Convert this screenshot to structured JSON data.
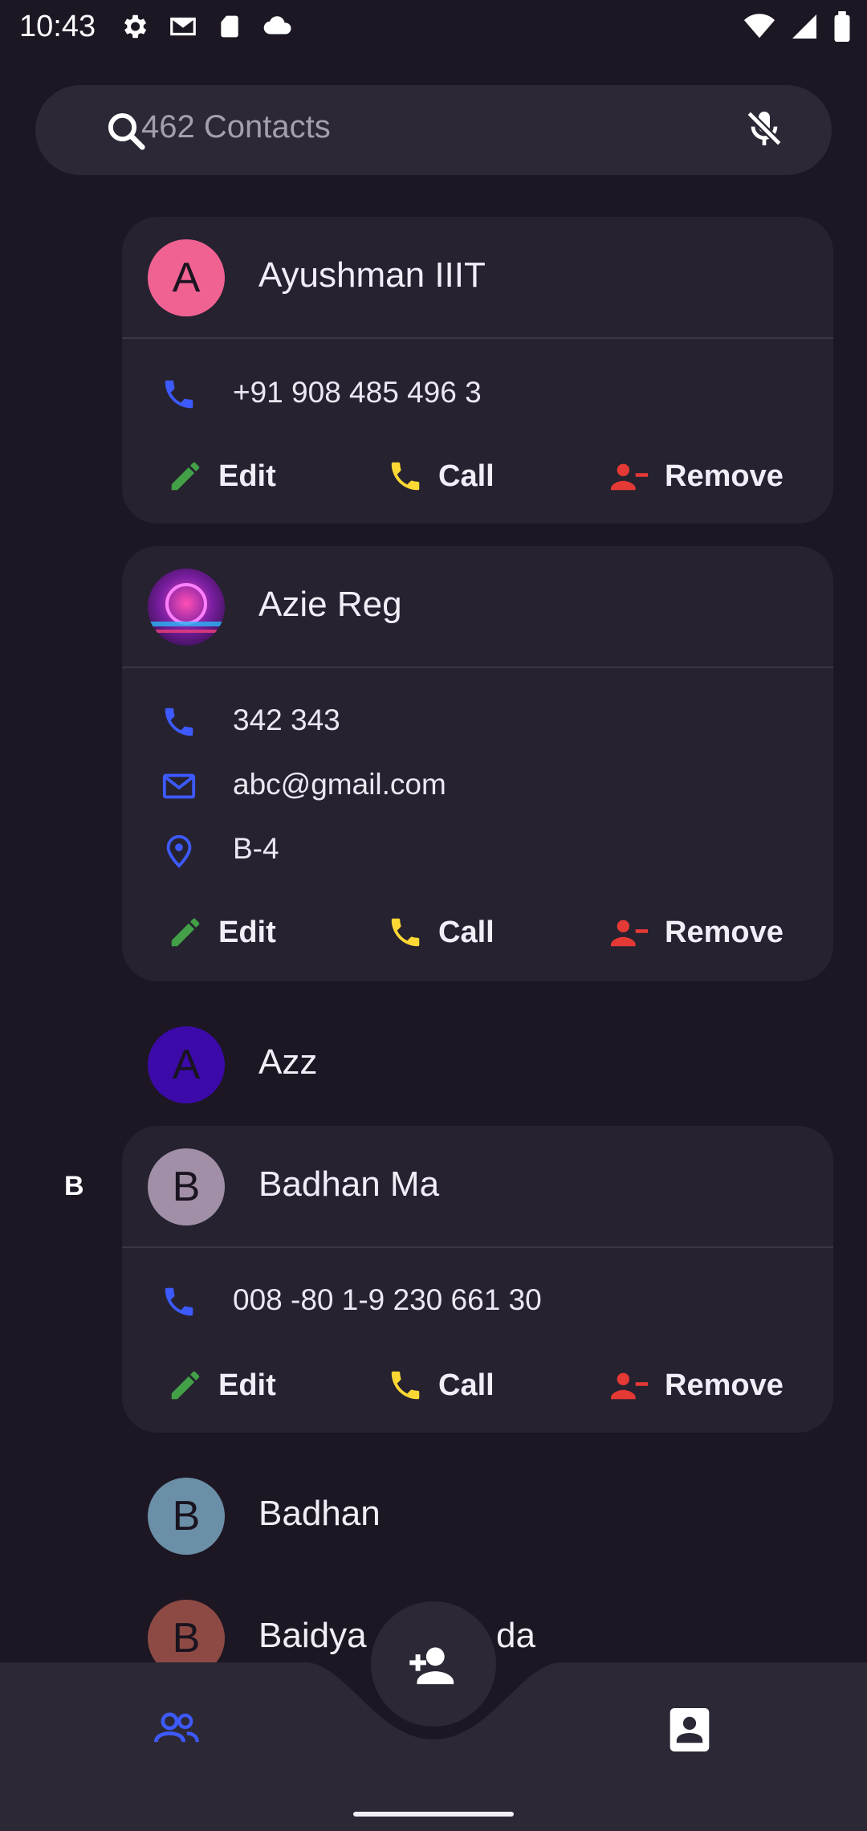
{
  "status_bar": {
    "time": "10:43"
  },
  "search": {
    "placeholder": "462 Contacts"
  },
  "actions": {
    "edit": "Edit",
    "call": "Call",
    "remove": "Remove"
  },
  "contacts": [
    {
      "initial": "A",
      "name": "Ayushman IIIT",
      "avatar_color": "#f06292",
      "phone": "+91 908 485 496 3"
    },
    {
      "initial": "",
      "name": "Azie Reg",
      "phone": "342 343",
      "email": "abc@gmail.com",
      "address": "B-4"
    },
    {
      "initial": "A",
      "name": "Azz",
      "avatar_color": "#3b0aa8"
    },
    {
      "initial": "B",
      "name": "Badhan Ma",
      "avatar_color": "#a08fa6",
      "phone": "008 -80 1-9 230 661 30",
      "section": "B"
    },
    {
      "initial": "B",
      "name": "Badhan",
      "avatar_color": "#6b8fa6"
    },
    {
      "initial": "B",
      "name": "Baidya",
      "name_suffix": "da",
      "avatar_color": "#8d4a44"
    }
  ],
  "colors": {
    "accent": "#3d5afe",
    "edit": "#43a047",
    "call": "#fdd835",
    "remove": "#e53935"
  }
}
